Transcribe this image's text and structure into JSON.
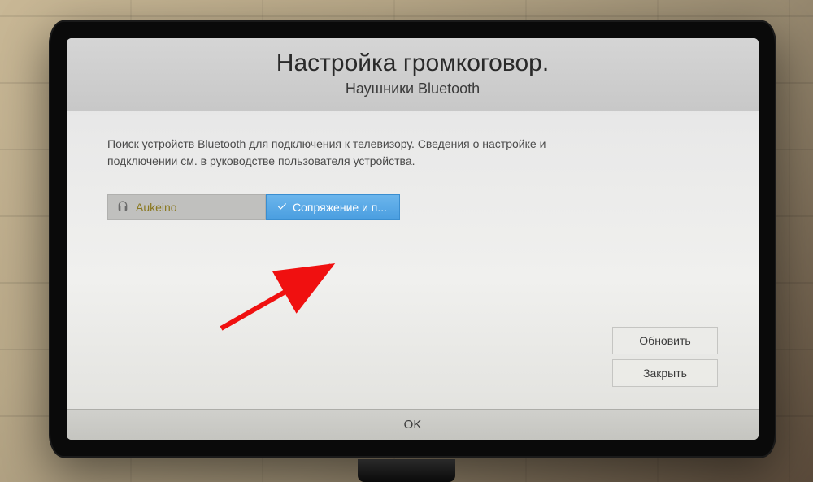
{
  "header": {
    "title": "Настройка громкоговор.",
    "subtitle": "Наушники Bluetooth"
  },
  "description": "Поиск устройств Bluetooth для подключения к телевизору. Сведения о настройке и подключении см. в руководстве пользователя устройства.",
  "device": {
    "name": "Aukeino"
  },
  "pair_button": {
    "label": "Сопряжение и п..."
  },
  "side_buttons": {
    "refresh": "Обновить",
    "close": "Закрыть"
  },
  "bottom": {
    "ok": "OK"
  }
}
